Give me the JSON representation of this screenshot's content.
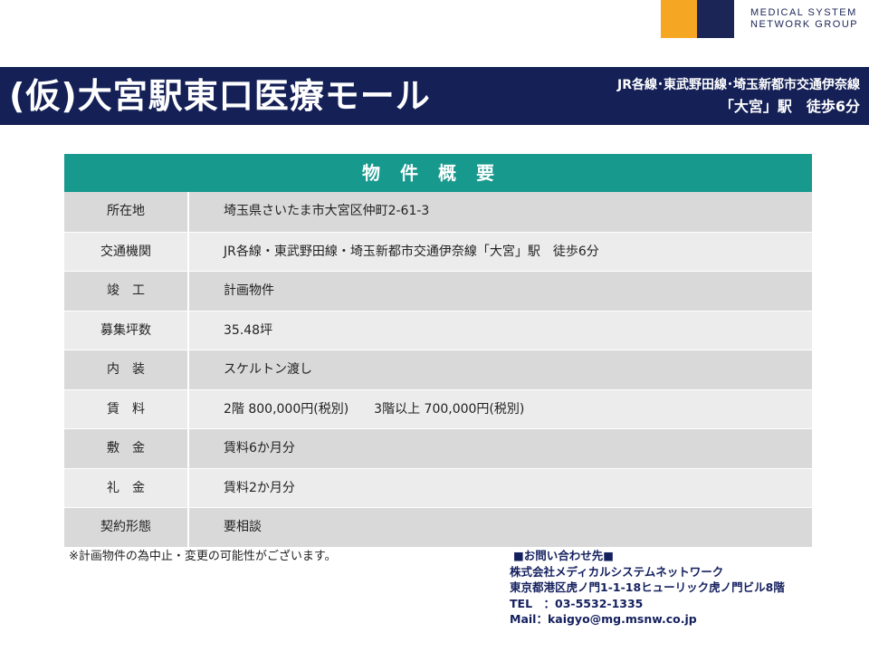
{
  "logo": {
    "colors": {
      "orange": "#f5a623",
      "navy": "#1b2556"
    },
    "line1": "MEDICAL SYSTEM",
    "line2": "NETWORK GROUP"
  },
  "banner": {
    "title": "(仮)大宮駅東口医療モール",
    "access_line1": "JR各線･東武野田線･埼玉新都市交通伊奈線",
    "access_line2": "「大宮」駅　徒歩6分",
    "background": "#142056"
  },
  "table": {
    "header": "物件概要",
    "header_color": "#17998d",
    "rows": [
      {
        "label": "所在地",
        "value": "埼玉県さいたま市大宮区仲町2-61-3"
      },
      {
        "label": "交通機関",
        "value": "JR各線・東武野田線・埼玉新都市交通伊奈線「大宮」駅　徒歩6分"
      },
      {
        "label": "竣　工",
        "value": "計画物件"
      },
      {
        "label": "募集坪数",
        "value": "35.48坪"
      },
      {
        "label": "内　装",
        "value": "スケルトン渡し"
      },
      {
        "label": "賃　料",
        "value": "2階 800,000円(税別)　　3階以上 700,000円(税別)"
      },
      {
        "label": "敷　金",
        "value": "賃料6か月分"
      },
      {
        "label": "礼　金",
        "value": "賃料2か月分"
      },
      {
        "label": "契約形態",
        "value": "要相談"
      }
    ]
  },
  "note": "※計画物件の為中止・変更の可能性がございます。",
  "contact": {
    "heading": "■お問い合わせ先■",
    "company": "株式会社メディカルシステムネットワーク",
    "address": "東京都港区虎ノ門1-1-18ヒューリック虎ノ門ビル8階",
    "tel": "TEL　：03-5532-1335",
    "mail": "Mail：kaigyo@mg.msnw.co.jp"
  }
}
